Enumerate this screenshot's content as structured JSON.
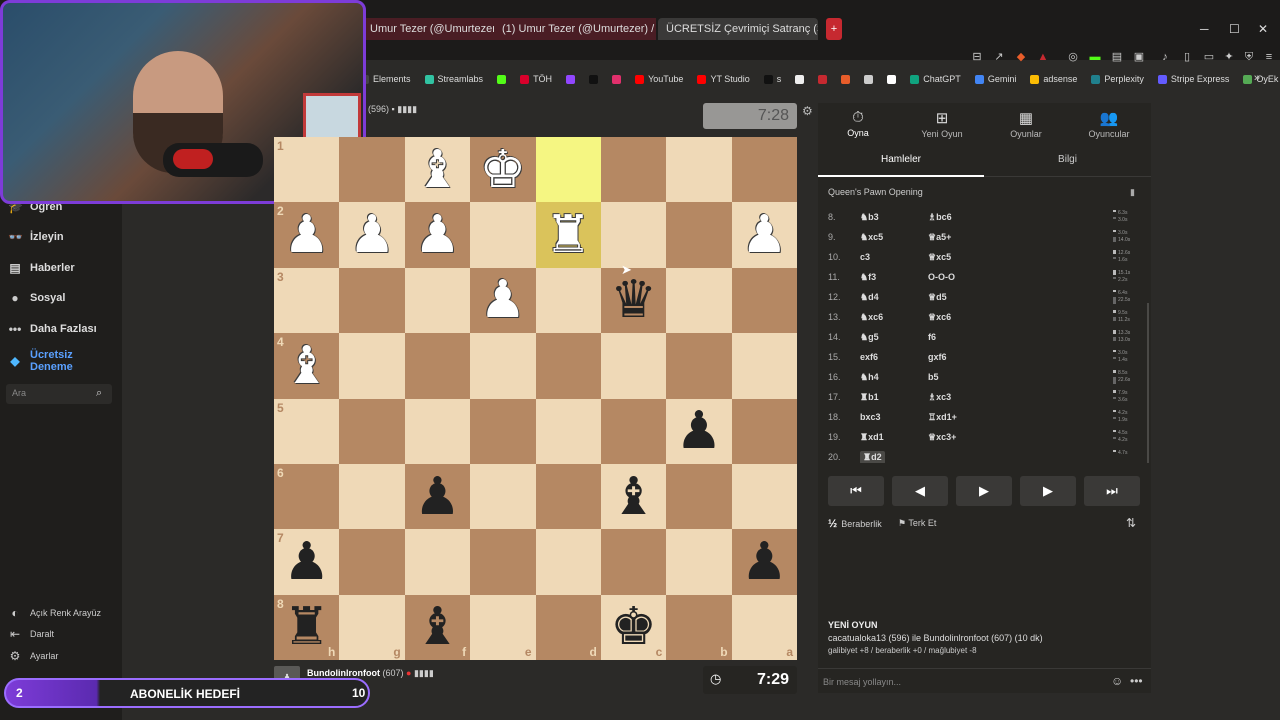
{
  "browser": {
    "tabs": [
      {
        "label": "Umur Tezer (@Umurtezer) / X"
      },
      {
        "label": "(1) Umur Tezer (@Umurtezer) / X"
      },
      {
        "label": "ÜCRETSİZ Çevrimiçi Satranç (S"
      }
    ],
    "new_tab": "+",
    "tab_close": "✕",
    "window_controls": {
      "minimize": "─",
      "maximize": "☐",
      "close": "✕"
    }
  },
  "bookmarks": [
    {
      "label": "Elements",
      "color": "#444444"
    },
    {
      "label": "Streamlabs",
      "color": "#31c3a2"
    },
    {
      "label": "",
      "color": "#53fc18"
    },
    {
      "label": "TÖH",
      "color": "#d9002b"
    },
    {
      "label": "",
      "color": "#9146ff"
    },
    {
      "label": "",
      "color": "#111111"
    },
    {
      "label": "",
      "color": "#e1306c"
    },
    {
      "label": "YouTube",
      "color": "#ff0000"
    },
    {
      "label": "YT Studio",
      "color": "#ff0000"
    },
    {
      "label": "s",
      "color": "#111111"
    },
    {
      "label": "",
      "color": "#eeeeee"
    },
    {
      "label": "",
      "color": "#c62930"
    },
    {
      "label": "",
      "color": "#e85d2a"
    },
    {
      "label": "",
      "color": "#cccccc"
    },
    {
      "label": "",
      "color": "#ffffff"
    },
    {
      "label": "ChatGPT",
      "color": "#10a37f"
    },
    {
      "label": "Gemini",
      "color": "#4285f4"
    },
    {
      "label": "adsense",
      "color": "#fbbc04"
    },
    {
      "label": "Perplexity",
      "color": "#20808d"
    },
    {
      "label": "Stripe Express",
      "color": "#635bff"
    },
    {
      "label": "OyEk",
      "color": "#55aa55"
    }
  ],
  "sidebar": {
    "items": [
      {
        "label": "Öğren",
        "icon": "graduation-icon"
      },
      {
        "label": "İzleyin",
        "icon": "binoculars-icon"
      },
      {
        "label": "Haberler",
        "icon": "news-icon"
      },
      {
        "label": "Sosyal",
        "icon": "people-icon"
      },
      {
        "label": "Daha Fazlası",
        "icon": "more-icon"
      },
      {
        "label": "Ücretsiz Deneme",
        "icon": "diamond-icon"
      }
    ],
    "search_placeholder": "Ara",
    "bottom": [
      {
        "label": "Açık Renk Arayüz"
      },
      {
        "label": "Daralt"
      },
      {
        "label": "Ayarlar"
      }
    ]
  },
  "opponent": {
    "rating_text": "(596)",
    "clock": "7:28"
  },
  "me": {
    "name": "Bundolinlronfoot",
    "rating": "(607)",
    "clock": "7:29"
  },
  "subscription": {
    "count": "2",
    "label": "ABONELİK HEDEFİ",
    "goal": "10"
  },
  "board": {
    "ranks": [
      "1",
      "2",
      "3",
      "4",
      "5",
      "6",
      "7",
      "8"
    ],
    "files": [
      "h",
      "g",
      "f",
      "e",
      "d",
      "c",
      "b",
      "a"
    ],
    "rows": [
      [
        "",
        "",
        "wB",
        "wK",
        "",
        "",
        "",
        ""
      ],
      [
        "wP",
        "wP",
        "wP",
        "",
        "wR",
        "",
        "",
        "wP"
      ],
      [
        "",
        "",
        "",
        "wP",
        "",
        "bQ",
        "",
        ""
      ],
      [
        "wB",
        "",
        "",
        "",
        "",
        "",
        "",
        ""
      ],
      [
        "",
        "",
        "",
        "",
        "",
        "",
        "bP",
        ""
      ],
      [
        "",
        "",
        "bP",
        "",
        "",
        "bB",
        "",
        ""
      ],
      [
        "bP",
        "",
        "",
        "",
        "",
        "",
        "",
        "bP"
      ],
      [
        "bR",
        "",
        "bB",
        "",
        "",
        "bK",
        "",
        ""
      ]
    ]
  },
  "panel": {
    "tabs": [
      {
        "label": "Oyna",
        "icon": "stopwatch-icon"
      },
      {
        "label": "Yeni Oyun",
        "icon": "plus-icon"
      },
      {
        "label": "Oyunlar",
        "icon": "board-icon"
      },
      {
        "label": "Oyuncular",
        "icon": "players-icon"
      }
    ],
    "subtabs": {
      "moves": "Hamleler",
      "info": "Bilgi"
    },
    "opening": "Queen's Pawn Opening",
    "moves": [
      {
        "n": "8.",
        "w": "♞b3",
        "b": "♗bc6",
        "t": [
          "6.3s",
          "3.0s"
        ]
      },
      {
        "n": "9.",
        "w": "♞xc5",
        "b": "♕a5+",
        "t": [
          "3.0s",
          "14.0s"
        ]
      },
      {
        "n": "10.",
        "w": "c3",
        "b": "♕xc5",
        "t": [
          "12.6s",
          "1.6s"
        ]
      },
      {
        "n": "11.",
        "w": "♞f3",
        "b": "O-O-O",
        "t": [
          "15.1s",
          "2.2s"
        ]
      },
      {
        "n": "12.",
        "w": "♞d4",
        "b": "♕d5",
        "t": [
          "6.4s",
          "22.5s"
        ]
      },
      {
        "n": "13.",
        "w": "♞xc6",
        "b": "♕xc6",
        "t": [
          "9.5s",
          "11.2s"
        ]
      },
      {
        "n": "14.",
        "w": "♞g5",
        "b": "f6",
        "t": [
          "13.3s",
          "13.0s"
        ]
      },
      {
        "n": "15.",
        "w": "exf6",
        "b": "gxf6",
        "t": [
          "3.0s",
          "1.4s"
        ]
      },
      {
        "n": "16.",
        "w": "♞h4",
        "b": "b5",
        "t": [
          "8.5s",
          "22.6s"
        ]
      },
      {
        "n": "17.",
        "w": "♜b1",
        "b": "♗xc3",
        "t": [
          "7.9s",
          "3.6s"
        ]
      },
      {
        "n": "18.",
        "w": "bxc3",
        "b": "♖xd1+",
        "t": [
          "4.2s",
          "1.9s"
        ]
      },
      {
        "n": "19.",
        "w": "♜xd1",
        "b": "♕xc3+",
        "t": [
          "4.5s",
          "4.2s"
        ]
      },
      {
        "n": "20.",
        "w": "♜d2",
        "b": "",
        "t": [
          "4.7s"
        ]
      }
    ],
    "nav": {
      "first": "⏮",
      "prev": "◀",
      "play": "▶",
      "next": "▶",
      "last": "⏭"
    },
    "draw_label": "Beraberlik",
    "resign_label": "Terk Et",
    "new_game": {
      "title": "YENİ OYUN",
      "line1": "cacatualoka13 (596) ile Bundolinlronfoot (607) (10 dk)",
      "line2": "galibiyet +8 / beraberlik +0 / mağlubiyet -8"
    },
    "chat_placeholder": "Bir mesaj yollayın..."
  }
}
